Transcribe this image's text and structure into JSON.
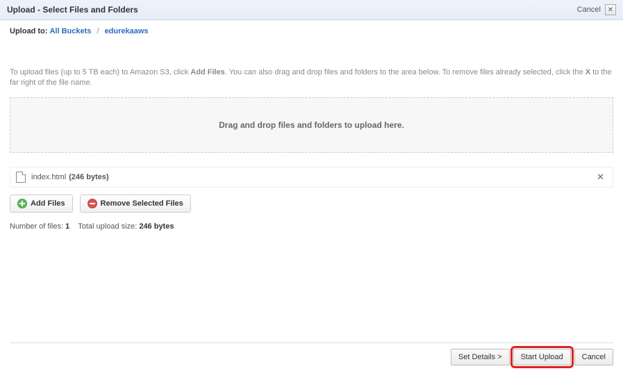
{
  "header": {
    "title": "Upload - Select Files and Folders",
    "cancel": "Cancel"
  },
  "breadcrumb": {
    "label": "Upload to:",
    "root": "All Buckets",
    "current": "edurekaaws"
  },
  "instructions": {
    "part1": "To upload files (up to 5 TB each) to Amazon S3, click ",
    "add_files_bold": "Add Files",
    "part2": ". You can also drag and drop files and folders to the area below. To remove files already selected, click the ",
    "x_bold": "X",
    "part3": " to the far right of the file name."
  },
  "dropzone": {
    "text": "Drag and drop files and folders to upload here."
  },
  "files": [
    {
      "name": "index.html",
      "size": "(246 bytes)"
    }
  ],
  "actions": {
    "add_files": "Add Files",
    "remove_selected": "Remove Selected Files"
  },
  "stats": {
    "num_label": "Number of files: ",
    "num_value": "1",
    "size_label": "Total upload size: ",
    "size_value": "246 bytes"
  },
  "footer": {
    "set_details": "Set Details >",
    "start_upload": "Start Upload",
    "cancel": "Cancel"
  }
}
